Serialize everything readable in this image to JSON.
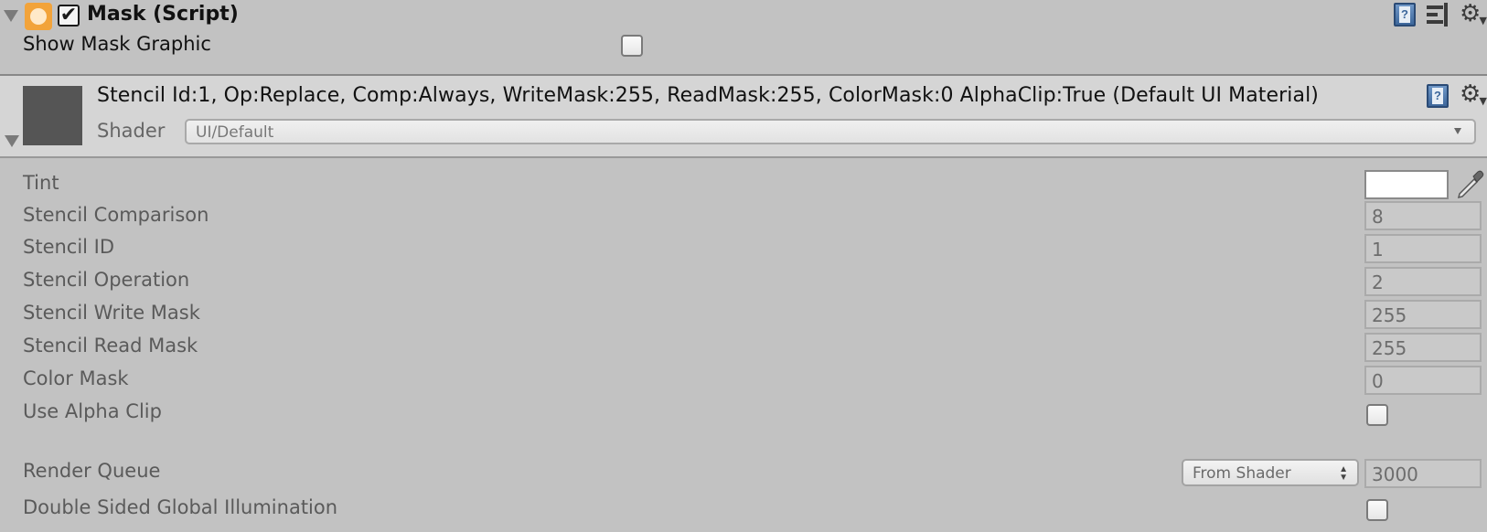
{
  "component": {
    "title": "Mask (Script)",
    "enabled_glyph": "✔",
    "icons": [
      "foldout-arrow",
      "mask-component-icon",
      "help-icon",
      "presets-icon",
      "gear-icon"
    ],
    "accent_color": "#f2a33a"
  },
  "mask": {
    "show_mask_graphic_label": "Show Mask Graphic",
    "show_mask_graphic_checked": false
  },
  "material": {
    "title": "Stencil Id:1, Op:Replace, Comp:Always, WriteMask:255, ReadMask:255, ColorMask:0 AlphaClip:True (Default UI Material)",
    "shader_label": "Shader",
    "shader_value": "UI/Default",
    "preview_color": "#555555"
  },
  "properties": {
    "tint": {
      "label": "Tint",
      "color": "#ffffff"
    },
    "stencil_comparison": {
      "label": "Stencil Comparison",
      "value": "8"
    },
    "stencil_id": {
      "label": "Stencil ID",
      "value": "1"
    },
    "stencil_operation": {
      "label": "Stencil Operation",
      "value": "2"
    },
    "stencil_write_mask": {
      "label": "Stencil Write Mask",
      "value": "255"
    },
    "stencil_read_mask": {
      "label": "Stencil Read Mask",
      "value": "255"
    },
    "color_mask": {
      "label": "Color Mask",
      "value": "0"
    },
    "use_alpha_clip": {
      "label": "Use Alpha Clip",
      "checked": false
    },
    "render_queue": {
      "label": "Render Queue",
      "mode": "From Shader",
      "value": "3000"
    },
    "double_sided_gi": {
      "label": "Double Sided Global Illumination",
      "checked": false
    }
  }
}
